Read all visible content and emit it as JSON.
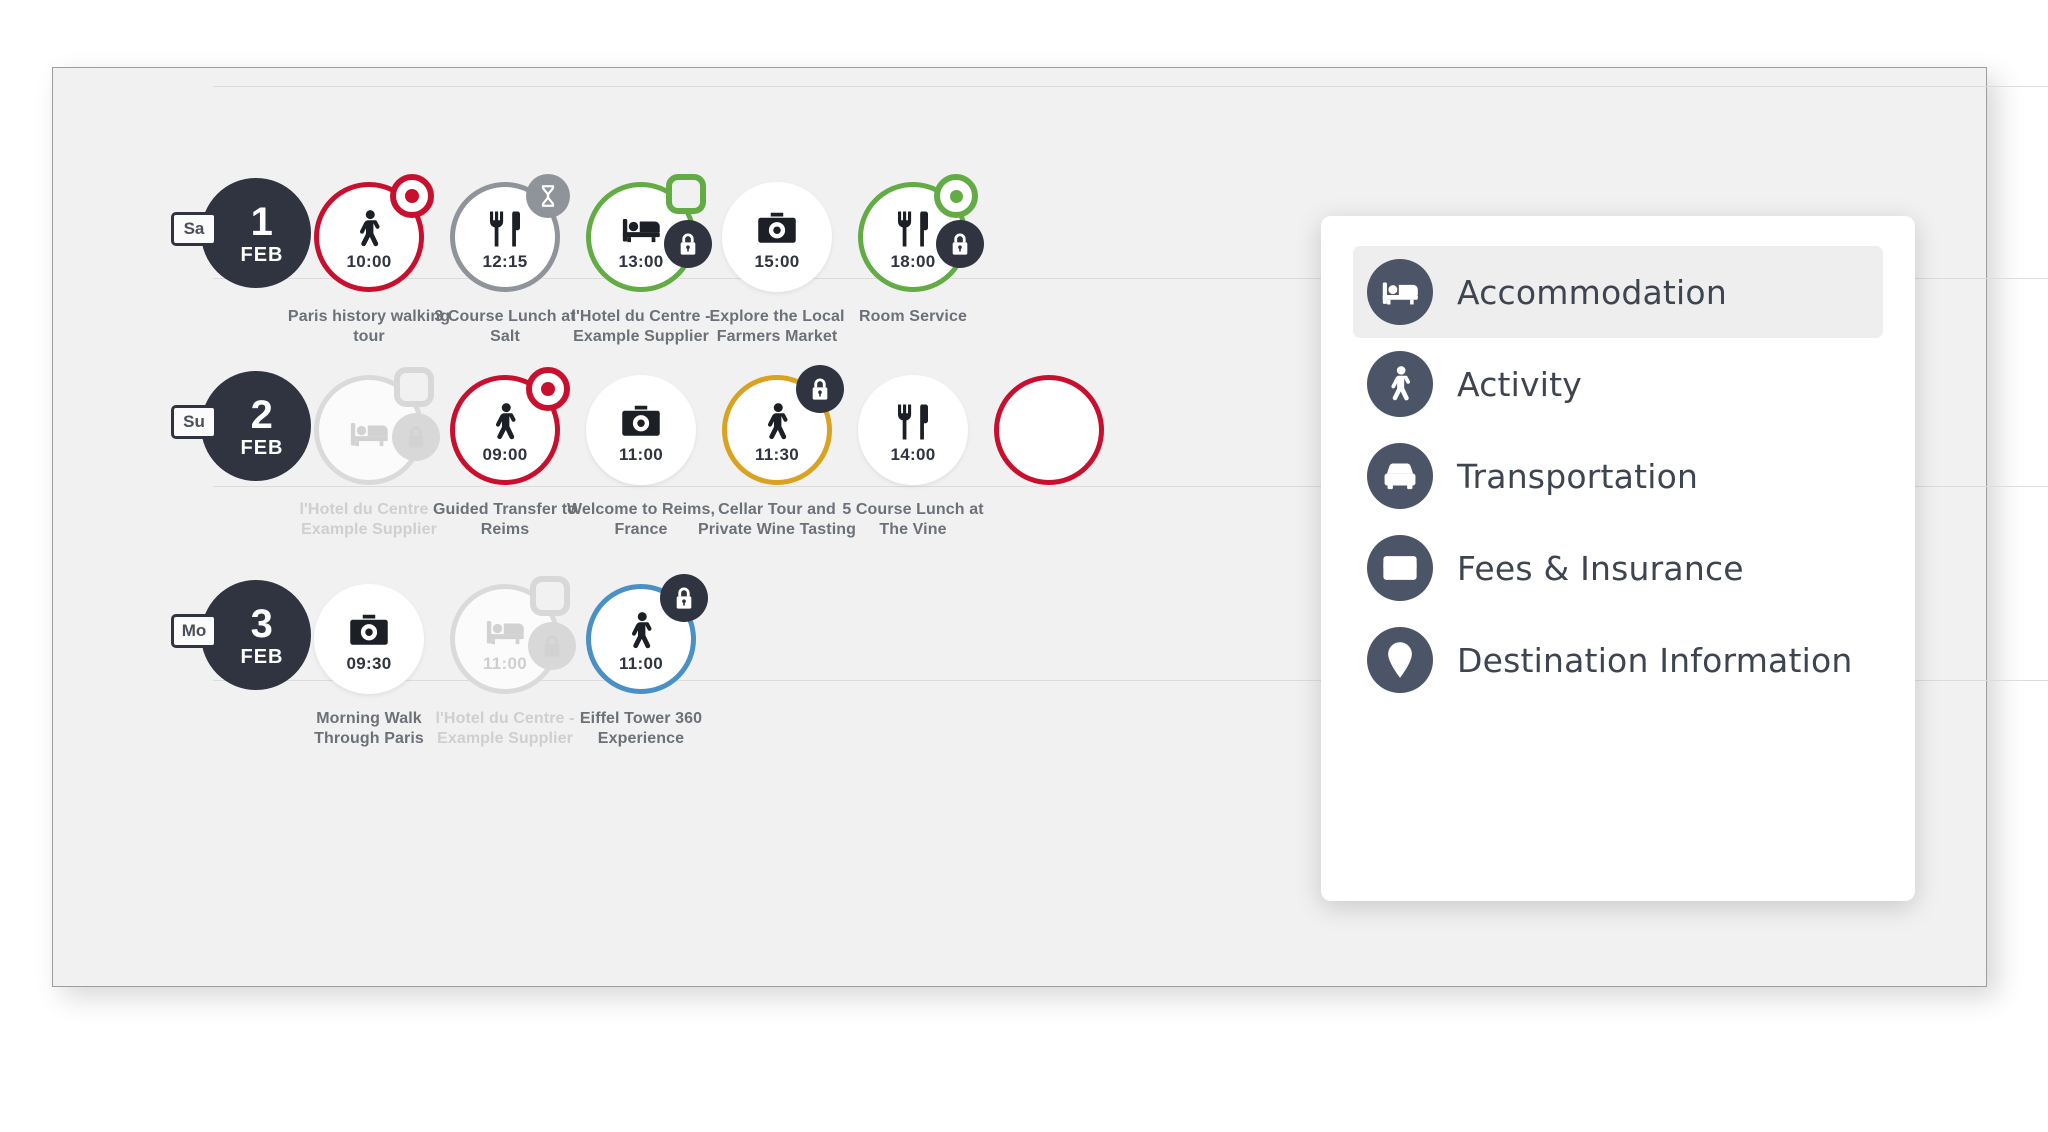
{
  "colors": {
    "dark": "#2f3440",
    "red": "#c8102e",
    "green": "#63ab45",
    "amber": "#d9a321",
    "blue": "#4a90c4",
    "grey": "#8f949b",
    "menu_icon_bg": "#4c5468",
    "panel_bg": "#f1f1f1"
  },
  "timeline": {
    "days": [
      {
        "dow": "Sa",
        "day_number": "1",
        "month": "FEB",
        "items": [
          {
            "icon": "walking-icon",
            "time": "10:00",
            "label": "Paris history walking tour",
            "ring": "#c8102e",
            "badge": "record",
            "lock": false,
            "faded": false
          },
          {
            "icon": "fork-knife-icon",
            "time": "12:15",
            "label": "3 Course Lunch at Salt",
            "ring": "#8f949b",
            "badge": "hourglass",
            "lock": false,
            "faded": false
          },
          {
            "icon": "bed-icon",
            "time": "13:00",
            "label": "l'Hotel du Centre - Example Supplier",
            "ring": "#63ab45",
            "badge": "square",
            "lock": true,
            "faded": false
          },
          {
            "icon": "camera-icon",
            "time": "15:00",
            "label": "Explore the Local Farmers Market",
            "ring": "none",
            "badge": "none",
            "lock": false,
            "faded": false
          },
          {
            "icon": "fork-knife-icon",
            "time": "18:00",
            "label": "Room Service",
            "ring": "#63ab45",
            "badge": "ring-green",
            "lock": true,
            "faded": false
          }
        ]
      },
      {
        "dow": "Su",
        "day_number": "2",
        "month": "FEB",
        "items": [
          {
            "icon": "bed-icon",
            "time": "",
            "label": "l'Hotel du Centre - Example Supplier",
            "ring": "#dadada",
            "badge": "square",
            "lock": true,
            "faded": true
          },
          {
            "icon": "walking-icon",
            "time": "09:00",
            "label": "Guided Transfer to Reims",
            "ring": "#c8102e",
            "badge": "record",
            "lock": false,
            "faded": false
          },
          {
            "icon": "camera-icon",
            "time": "11:00",
            "label": "Welcome to Reims, France",
            "ring": "none",
            "badge": "none",
            "lock": false,
            "faded": false
          },
          {
            "icon": "walking-icon",
            "time": "11:30",
            "label": "Cellar Tour and Private Wine Tasting",
            "ring": "#d9a321",
            "badge": "none",
            "lock": true,
            "faded": false
          },
          {
            "icon": "fork-knife-icon",
            "time": "14:00",
            "label": "5 Course Lunch at The Vine",
            "ring": "none",
            "badge": "none",
            "lock": false,
            "faded": false
          }
        ]
      },
      {
        "dow": "Mo",
        "day_number": "3",
        "month": "FEB",
        "items": [
          {
            "icon": "camera-icon",
            "time": "09:30",
            "label": "Morning Walk Through Paris",
            "ring": "none",
            "badge": "none",
            "lock": false,
            "faded": false
          },
          {
            "icon": "bed-icon",
            "time": "11:00",
            "label": "l'Hotel du Centre - Example Supplier",
            "ring": "#dadada",
            "badge": "square",
            "lock": true,
            "faded": true
          },
          {
            "icon": "walking-icon",
            "time": "11:00",
            "label": "Eiffel Tower 360 Experience",
            "ring": "#4a90c4",
            "badge": "none",
            "lock": true,
            "faded": false
          }
        ]
      }
    ]
  },
  "dropdown": {
    "items": [
      {
        "icon": "bed-icon",
        "label": "Accommodation",
        "selected": true
      },
      {
        "icon": "walking-icon",
        "label": "Activity",
        "selected": false
      },
      {
        "icon": "car-icon",
        "label": "Transportation",
        "selected": false
      },
      {
        "icon": "card-icon",
        "label": "Fees & Insurance",
        "selected": false
      },
      {
        "icon": "map-pin-icon",
        "label": "Destination Information",
        "selected": false
      }
    ]
  }
}
